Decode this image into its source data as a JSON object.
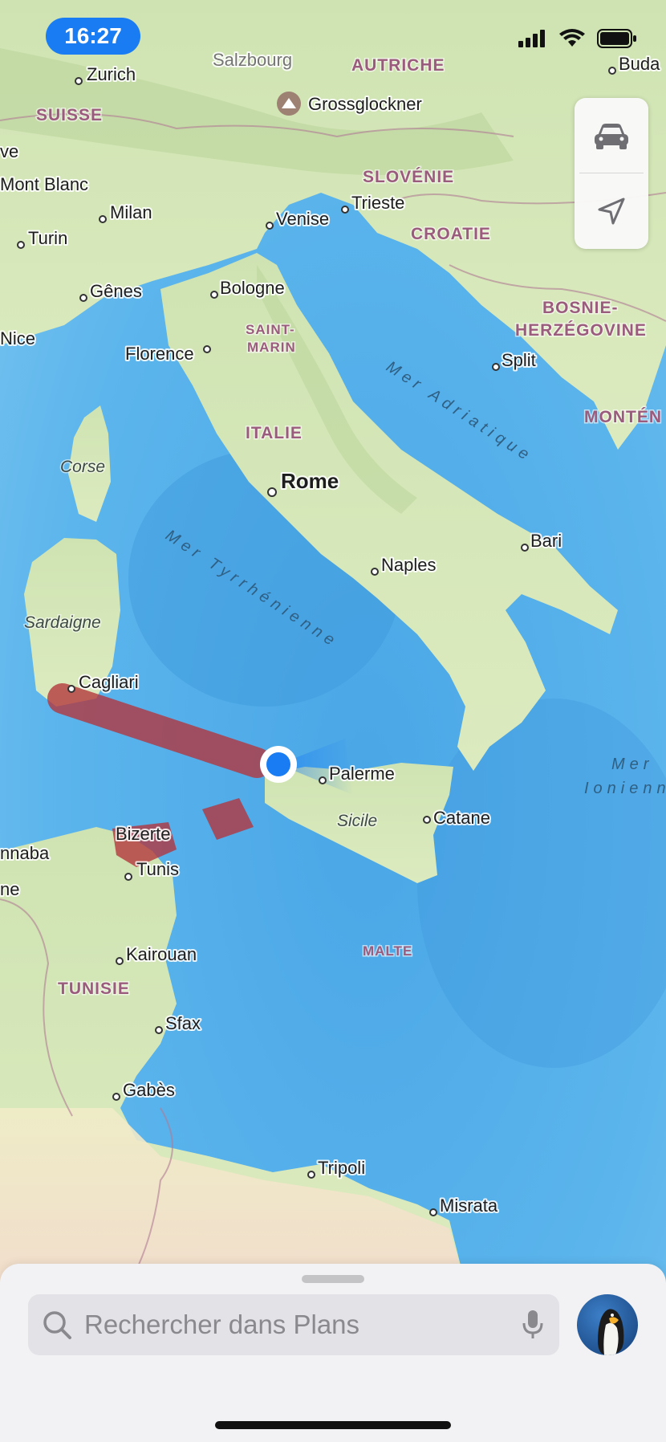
{
  "status_bar": {
    "time": "16:27"
  },
  "map": {
    "countries": [
      {
        "id": "suisse",
        "label": "SUISSE"
      },
      {
        "id": "autriche",
        "label": "AUTRICHE"
      },
      {
        "id": "slovenie",
        "label": "SLOVÉNIE"
      },
      {
        "id": "croatie",
        "label": "CROATIE"
      },
      {
        "id": "bosnie",
        "label1": "BOSNIE-",
        "label2": "HERZÉGOVINE"
      },
      {
        "id": "saint-marin",
        "label1": "SAINT-",
        "label2": "MARIN"
      },
      {
        "id": "italie",
        "label": "ITALIE"
      },
      {
        "id": "montenegro",
        "label": "MONTÉN"
      },
      {
        "id": "tunisie",
        "label": "TUNISIE"
      },
      {
        "id": "malte",
        "label": "MALTE"
      }
    ],
    "cities": {
      "zurich": "Zurich",
      "salzburg": "Salzbourg",
      "buda": "Buda",
      "grossglockner": "Grossglockner",
      "ve": "ve",
      "mont_blanc": "Mont Blanc",
      "milan": "Milan",
      "turin": "Turin",
      "venise": "Venise",
      "trieste": "Trieste",
      "genes": "Gênes",
      "bologne": "Bologne",
      "nice": "Nice",
      "florence": "Florence",
      "split": "Split",
      "rome": "Rome",
      "bari": "Bari",
      "naples": "Naples",
      "cagliari": "Cagliari",
      "palerme": "Palerme",
      "catane": "Catane",
      "bizerte": "Bizerte",
      "tunis": "Tunis",
      "annaba": "nnaba",
      "ne": "ne",
      "kairouan": "Kairouan",
      "sfax": "Sfax",
      "gabes": "Gabès",
      "tripoli": "Tripoli",
      "misrata": "Misrata"
    },
    "islands": {
      "corse": "Corse",
      "sardaigne": "Sardaigne",
      "sicile": "Sicile"
    },
    "seas": {
      "adriatique": "Mer Adriatique",
      "tyrrhenienne": "Mer Tyrrhénienne",
      "ionienne_1": "Mer",
      "ionienne_2": "Ionienn"
    },
    "route_color": "#b3333a",
    "location_color": "#1a7cf3"
  },
  "controls": {
    "drive_icon": "car-icon",
    "locate_icon": "location-arrow-icon"
  },
  "search": {
    "placeholder": "Rechercher dans Plans"
  }
}
